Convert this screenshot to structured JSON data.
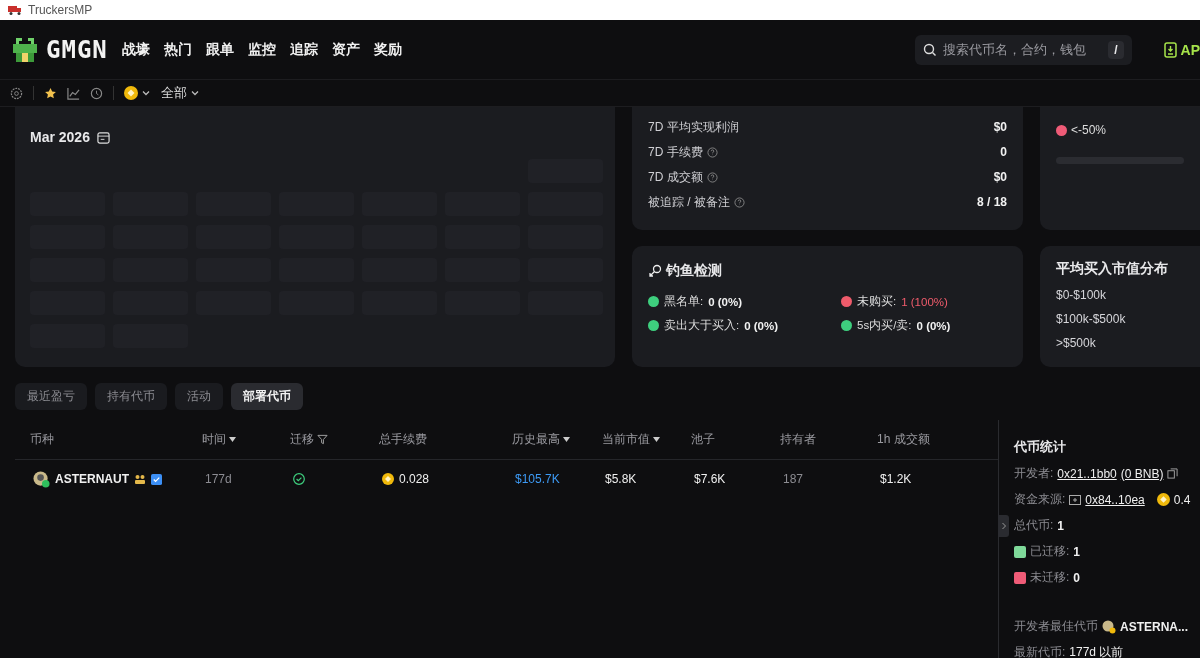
{
  "window": {
    "title": "TruckersMP"
  },
  "nav": {
    "logo": "GMGN",
    "items": [
      "战壕",
      "热门",
      "跟单",
      "监控",
      "追踪",
      "资产",
      "奖励"
    ],
    "search": {
      "placeholder": "搜索代币名，合约，钱包",
      "shortcut": "/"
    },
    "app_button": "AP"
  },
  "toolbar": {
    "filter": "全部"
  },
  "calendar": {
    "month": "Mar 2026"
  },
  "stats": [
    {
      "label": "7D 平均实现利润",
      "value": "$0",
      "help": false
    },
    {
      "label": "7D 手续费",
      "value": "0",
      "help": true
    },
    {
      "label": "7D 成交额",
      "value": "$0",
      "help": true
    },
    {
      "label": "被追踪 / 被备注",
      "value": "8 / 18",
      "help": true
    }
  ],
  "pnl_legend": [
    {
      "label": "<-50%",
      "color": "#ef5b77"
    }
  ],
  "phishing": {
    "title": "钓鱼检测",
    "items": [
      {
        "label": "黑名单:",
        "value": "0 (0%)",
        "color": "#3ecf7e",
        "alert": false
      },
      {
        "label": "未购买:",
        "value": "1 (100%)",
        "color": "#ef5b6b",
        "alert": true
      },
      {
        "label": "卖出大于买入:",
        "value": "0 (0%)",
        "color": "#3ecf7e",
        "alert": false
      },
      {
        "label": "5s内买/卖:",
        "value": "0 (0%)",
        "color": "#3ecf7e",
        "alert": false
      }
    ]
  },
  "market_cap": {
    "title": "平均买入市值分布",
    "ranges": [
      "$0-$100k",
      "$100k-$500k",
      ">$500k"
    ]
  },
  "tabs": [
    {
      "label": "最近盈亏",
      "selected": false
    },
    {
      "label": "持有代币",
      "selected": false
    },
    {
      "label": "活动",
      "selected": false
    },
    {
      "label": "部署代币",
      "selected": true
    }
  ],
  "table": {
    "columns": [
      {
        "label": "币种",
        "sort": false,
        "filter": false
      },
      {
        "label": "时间",
        "sort": true,
        "filter": false
      },
      {
        "label": "迁移",
        "sort": false,
        "filter": true
      },
      {
        "label": "总手续费",
        "sort": false,
        "filter": false
      },
      {
        "label": "历史最高",
        "sort": true,
        "filter": false
      },
      {
        "label": "当前市值",
        "sort": true,
        "filter": false
      },
      {
        "label": "池子",
        "sort": false,
        "filter": false
      },
      {
        "label": "持有者",
        "sort": false,
        "filter": false
      },
      {
        "label": "1h 成交额",
        "sort": false,
        "filter": false
      }
    ],
    "rows": [
      {
        "token": "ASTERNAUT",
        "time": "177d",
        "migrated": true,
        "fee": "0.028",
        "ath": "$105.7K",
        "market_cap": "$5.8K",
        "pool": "$7.6K",
        "holders": "187",
        "volume_1h": "$1.2K"
      }
    ]
  },
  "token_stats": {
    "title": "代币统计",
    "developer": {
      "label": "开发者:",
      "address": "0x21..1bb0",
      "balance": "(0 BNB)"
    },
    "funding": {
      "label": "资金来源:",
      "address": "0x84..10ea",
      "amount": "0.4"
    },
    "total": {
      "label": "总代币:",
      "value": "1"
    },
    "legend": [
      {
        "label": "已迁移:",
        "value": "1",
        "color": "#7fd99a"
      },
      {
        "label": "未迁移:",
        "value": "0",
        "color": "#ef5b77"
      }
    ],
    "best": {
      "label": "开发者最佳代币",
      "token": "ASTERNA..."
    },
    "latest": {
      "label": "最新代币:",
      "value": "177d 以前"
    }
  }
}
